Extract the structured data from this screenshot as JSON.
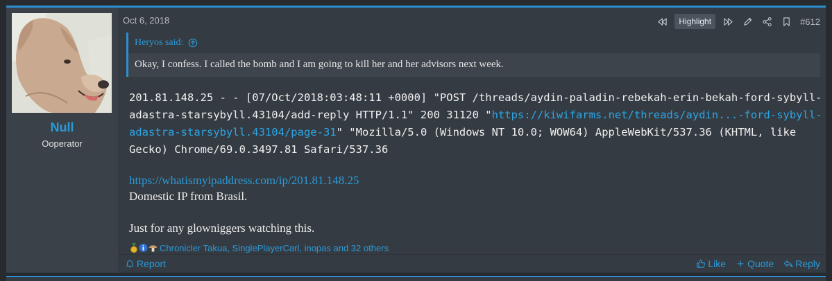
{
  "post": {
    "date": "Oct 6, 2018",
    "highlight_label": "Highlight",
    "post_number": "#612",
    "accent_color": "#2b8fd0"
  },
  "user": {
    "name": "Null",
    "title": "Ooperator"
  },
  "quote": {
    "author": "Heryos said:",
    "text": "Okay, I confess. I called the bomb and I am going to kill her and her advisors next week."
  },
  "code": {
    "part1": "201.81.148.25 - - [07/Oct/2018:03:48:11 +0000] \"POST /threads/aydin-paladin-rebekah-erin-bekah-ford-sybyll-adastra-starsybyll.43104/add-reply HTTP/1.1\" 200 31120 \"",
    "link": "https://kiwifarms.net/threads/aydin...-ford-sybyll-adastra-starsybyll.43104/page-31",
    "part2": "\" \"Mozilla/5.0 (Windows NT 10.0; WOW64) AppleWebKit/537.36 (KHTML, like Gecko) Chrome/69.0.3497.81 Safari/537.36"
  },
  "body": {
    "link": "https://whatismyipaddress.com/ip/201.81.148.25",
    "line1": "Domestic IP from Brasil.",
    "line2": "Just for any glowniggers watching this."
  },
  "reactions": {
    "text": "Chronicler Takua, SinglePlayerCarl, inopas and 32 others",
    "icons": [
      "winner-icon",
      "informative-icon",
      "mushroom-icon"
    ]
  },
  "footer": {
    "report": "Report",
    "like": "Like",
    "quote": "Quote",
    "reply": "Reply"
  }
}
